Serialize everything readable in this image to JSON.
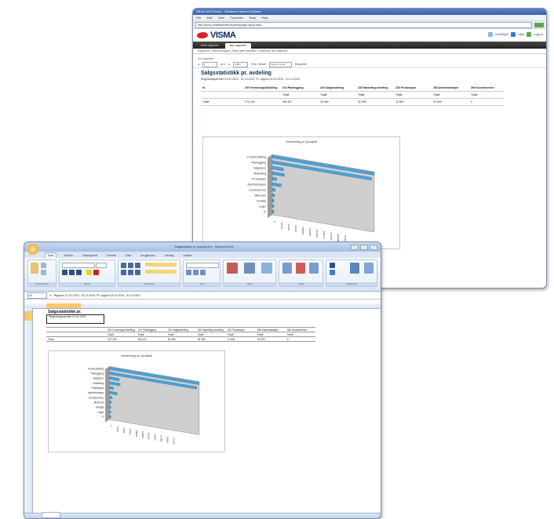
{
  "browser": {
    "window_title": "Vilma Self Service - Windows Internet Explorer",
    "menu": [
      "File",
      "Edit",
      "View",
      "Favorites",
      "Tools",
      "Help"
    ],
    "url": "http://vilma.no/selfservice/reports/budget-report.aspx",
    "brand": "VISMA",
    "top_links": [
      "Innstillinger",
      "Hjelp",
      "Logg ut"
    ],
    "tabs": [
      "Mine rapporter",
      "Nye rapporter"
    ],
    "subnav": "Rapporter | Administrasjon | Mine faste utskrifter | Rapporter alle rapporter",
    "crumb": "Vis rapporter",
    "toolbar": {
      "page": "1",
      "of": "av 1",
      "zoom": "100%",
      "find": "Finn | Neste",
      "export": "Velg et format",
      "export_btn": "Eksporter"
    },
    "heading": "Salgsstatistikk pr. avdeling",
    "description": "Regnskapsperiode 01.01.2010 - 31.12.2010, Pr. rapport 01.01.2010 - 31.12.2010",
    "table": {
      "columns": [
        "Id",
        "200 Forsknings/Utvikling",
        "210 Planlegging",
        "220 Salgsavdeling",
        "230 Marketing avdeling",
        "240 Produksjon",
        "250 Administrasjon",
        "260 Kundeservice"
      ],
      "subheader": [
        "",
        "",
        "Totalt",
        "Totalt",
        "Totalt",
        "Totalt",
        "Totalt",
        "Totalt"
      ],
      "rows": [
        [
          "Totalt",
          "272 100",
          "264 617",
          "29 460",
          "32 350",
          "11 800",
          "23 600",
          "0"
        ]
      ]
    },
    "chart_title": "Omsetning pr. prosjekt"
  },
  "excel": {
    "window_title": "Salgsstatistikk pr. avdeling.xlsx - Microsoft Excel",
    "tabs": [
      "Start",
      "Sett inn",
      "Sideoppsett",
      "Formler",
      "Data",
      "Se gjennom",
      "Visning",
      "Utvikler"
    ],
    "ribbon_groups": [
      "Utklippstavle",
      "Skrift",
      "Justering",
      "Tall",
      "Stiler",
      "Celler",
      "Redigering"
    ],
    "name_box": "A1",
    "formula": "Rapport: 01.01.2010 - 31.12.2010, Pr. rapport 01.01.2010 - 31.12.2010",
    "sheet_title": "Salgsstatistikk pr.",
    "sheet_sub": "Regnskapsperiode 01.01.2010",
    "table": {
      "columns": [
        "",
        "",
        "200 Forsknings/Utvikling",
        "210 Planlegging",
        "220 Salgsavdeling",
        "230 Marketing avdeling",
        "240 Produksjon",
        "250 Administrasjon",
        "260 Kundeservice"
      ],
      "subheader": [
        "",
        "",
        "Totalt",
        "Totalt",
        "Totalt",
        "Totalt",
        "Totalt",
        "Totalt",
        "Totalt"
      ],
      "rows": [
        [
          "Totalt",
          "",
          "272 100",
          "264 617",
          "29 460",
          "32 350",
          "11 800",
          "23 600",
          "0"
        ]
      ]
    },
    "chart_title": "Omsetning pr. prosjekt"
  },
  "chart_data": [
    {
      "type": "bar",
      "orientation": "horizontal-3d",
      "title": "Omsetning pr. prosjekt",
      "categories": [
        "Forsk/Utvikling",
        "Planlegging",
        "Salgsavd.",
        "Marketing",
        "Produksjon",
        "Administrasjon",
        "Kundeservice",
        "Økonomi",
        "Innkjøp",
        "Lager",
        "IT"
      ],
      "values": [
        272100,
        264617,
        29460,
        32350,
        11800,
        23600,
        8000,
        6000,
        4000,
        3000,
        2000
      ],
      "colors": [
        "#4aa3d8"
      ]
    }
  ]
}
